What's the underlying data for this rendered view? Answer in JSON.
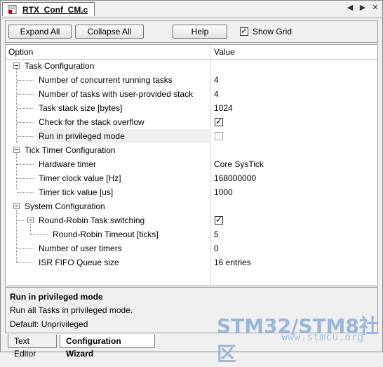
{
  "window": {
    "file_tab": "RTX_Conf_CM.c",
    "controls": [
      "◀",
      "▶",
      "✕"
    ]
  },
  "toolbar": {
    "expand_all": "Expand All",
    "collapse_all": "Collapse All",
    "help": "Help",
    "show_grid_label": "Show Grid",
    "show_grid_checked": true
  },
  "grid": {
    "header_option": "Option",
    "header_value": "Value",
    "rows": [
      {
        "label": "Task Configuration",
        "value": ""
      },
      {
        "label": "Number of concurrent running tasks",
        "value": "4"
      },
      {
        "label": "Number of tasks with user-provided stack",
        "value": "4"
      },
      {
        "label": "Task stack size [bytes]",
        "value": "1024"
      },
      {
        "label": "Check for the stack overflow",
        "value": "",
        "checked": true
      },
      {
        "label": "Run in privileged mode",
        "value": "",
        "checked": false
      },
      {
        "label": "Tick Timer Configuration",
        "value": ""
      },
      {
        "label": "Hardware timer",
        "value": "Core SysTick"
      },
      {
        "label": "Timer clock value [Hz]",
        "value": "168000000"
      },
      {
        "label": "Timer tick value [us]",
        "value": "1000"
      },
      {
        "label": "System Configuration",
        "value": ""
      },
      {
        "label": "Round-Robin Task switching",
        "value": "",
        "checked": true
      },
      {
        "label": "Round-Robin Timeout [ticks]",
        "value": "5"
      },
      {
        "label": "Number of user timers",
        "value": "0"
      },
      {
        "label": "ISR FIFO Queue size",
        "value": "16 entries"
      }
    ]
  },
  "description": {
    "title": "Run in privileged mode",
    "line1": "Run all Tasks in privileged mode.",
    "line2": "Default: Unprivileged"
  },
  "watermark": {
    "main": "STM32/STM8社区",
    "url": "www.stmcu.org"
  },
  "bottom_tabs": {
    "text_editor": "Text Editor",
    "config_wizard": "Configuration Wizard"
  }
}
